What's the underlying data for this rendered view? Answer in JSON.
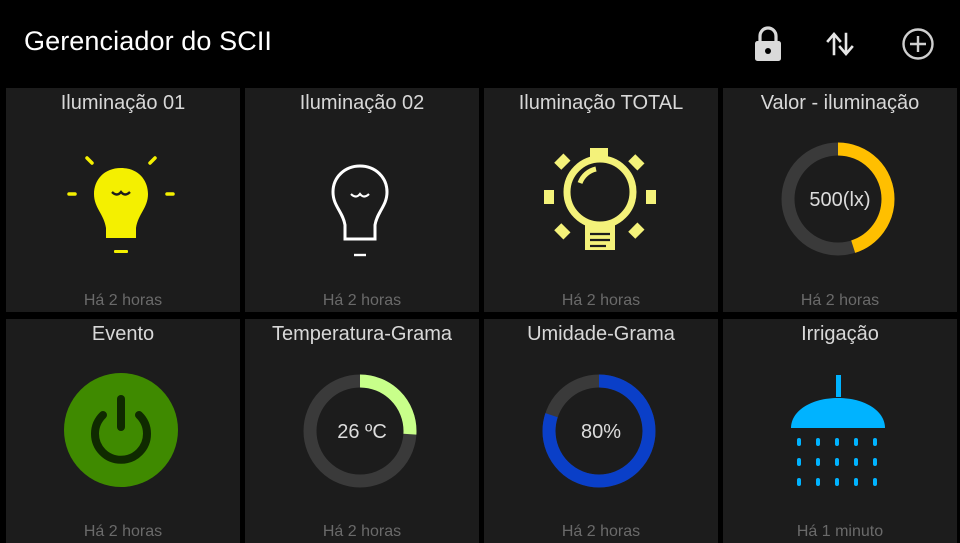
{
  "app": {
    "title": "Gerenciador do SCII",
    "actions": [
      "lock-icon",
      "swap-vertical-icon",
      "add-circle-icon"
    ]
  },
  "tiles": [
    {
      "title": "Iluminação 01",
      "time": "Há 2 horas",
      "icon": "lightbulb-on-icon",
      "state": "on",
      "color": "#f4f000"
    },
    {
      "title": "Iluminação 02",
      "time": "Há 2 horas",
      "icon": "lightbulb-off-icon",
      "state": "off",
      "color": "#ffffff"
    },
    {
      "title": "Iluminação TOTAL",
      "time": "Há 2 horas",
      "icon": "bright-bulb-icon",
      "color": "#f4f27a"
    },
    {
      "title": "Valor - iluminação",
      "time": "Há 2 horas",
      "gauge": {
        "value_label": "500(lx)",
        "fraction": 0.45,
        "color": "#ffbf00",
        "track": "#3a3a3a"
      }
    },
    {
      "title": "Evento",
      "time": "Há 2 horas",
      "icon": "power-icon",
      "color": "#3f8a00"
    },
    {
      "title": "Temperatura-Grama",
      "time": "Há 2 horas",
      "gauge": {
        "value_label": "26 ºC",
        "fraction": 0.26,
        "color": "#c8ff8a",
        "track": "#3a3a3a"
      }
    },
    {
      "title": "Umidade-Grama",
      "time": "Há 2 horas",
      "gauge": {
        "value_label": "80%",
        "fraction": 0.8,
        "color": "#0a3fc8",
        "track": "#3a3a3a"
      }
    },
    {
      "title": "Irrigação",
      "time": "Há 1 minuto",
      "icon": "shower-icon",
      "color": "#00b3ff"
    }
  ]
}
